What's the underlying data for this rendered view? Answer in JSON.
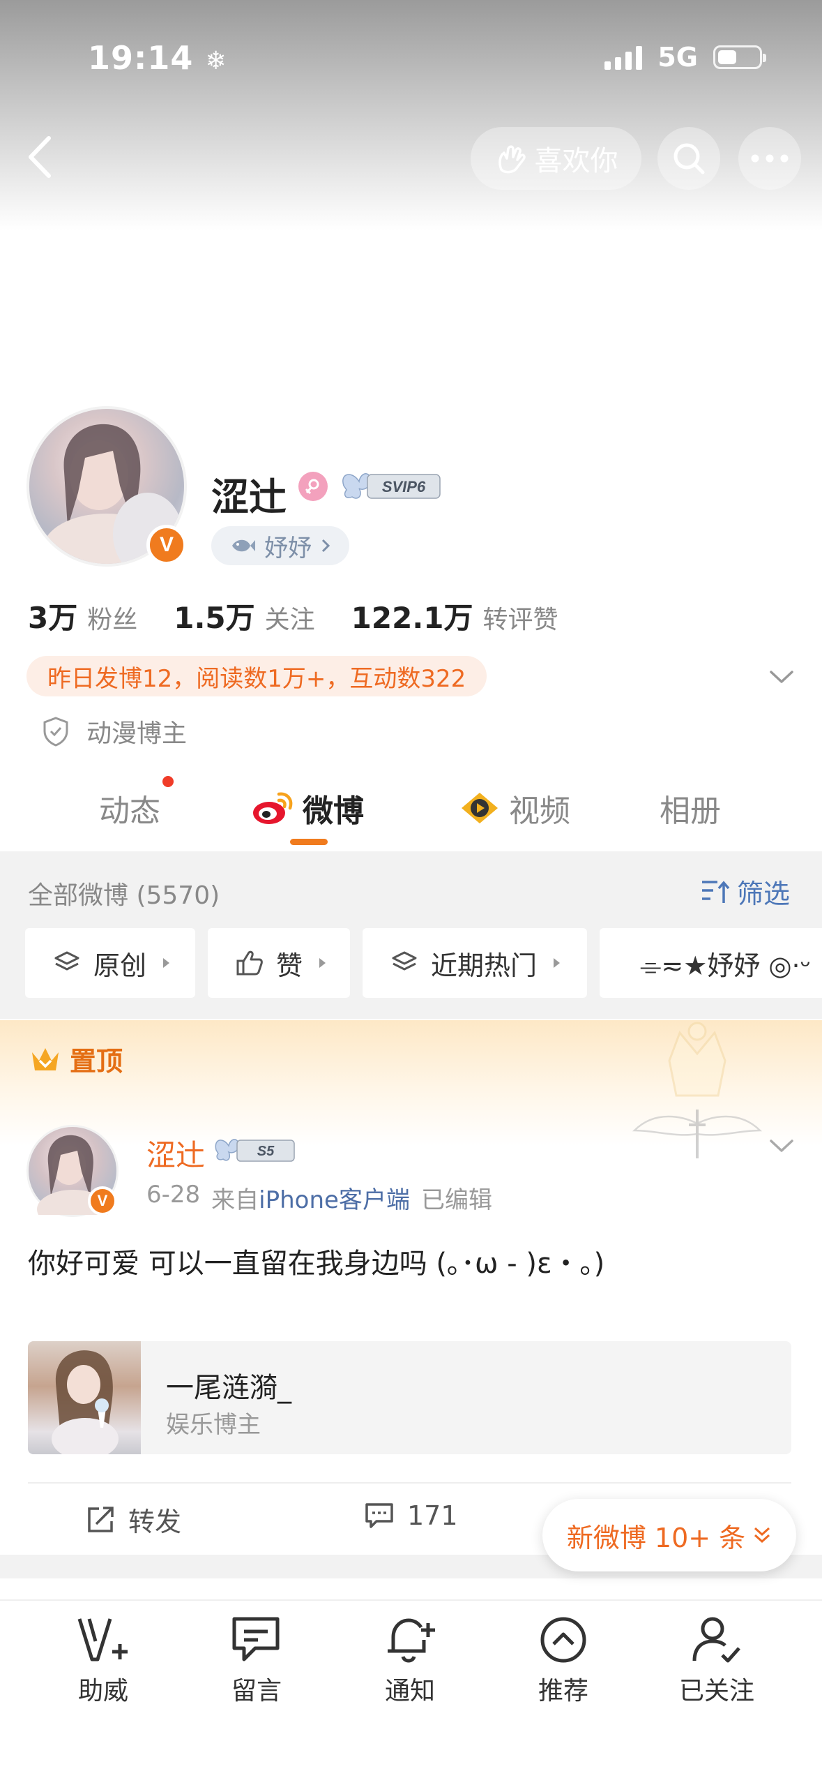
{
  "status_bar": {
    "time": "19:14",
    "network": "5G"
  },
  "header": {
    "like_you_label": "喜欢你"
  },
  "profile": {
    "name": "涩辻",
    "tag_name": "妤妤",
    "stats": [
      {
        "num": "3万",
        "label": "粉丝"
      },
      {
        "num": "1.5万",
        "label": "关注"
      },
      {
        "num": "122.1万",
        "label": "转评赞"
      }
    ],
    "summary": "昨日发博12，阅读数1万+，互动数322",
    "category": "动漫博主",
    "svip_text": "SVIP6"
  },
  "tabs": [
    {
      "label": "动态"
    },
    {
      "label": "微博"
    },
    {
      "label": "视频"
    },
    {
      "label": "相册"
    }
  ],
  "feed": {
    "all_count": "全部微博 (5570)",
    "filter_label": "筛选",
    "chips": [
      {
        "label": "原创"
      },
      {
        "label": "赞"
      },
      {
        "label": "近期热门"
      },
      {
        "label": "⌯≂★妤妤 ◎·ᵕ"
      }
    ]
  },
  "pinned": {
    "label": "置顶",
    "author": "涩辻",
    "badge_text": "S5",
    "date": "6-28",
    "source_prefix": "来自",
    "source": "iPhone客户端",
    "edited": "已编辑",
    "text": "你好可爱 可以一直留在我身边吗 (｡･ω - )ε・｡)",
    "shared_card": {
      "name": "一尾涟漪_",
      "subtitle": "娱乐博主"
    },
    "actions": {
      "repost": "转发",
      "comments": "171"
    }
  },
  "new_posts_label": "新微博 10+ 条",
  "bottom_nav": [
    {
      "label": "助威"
    },
    {
      "label": "留言"
    },
    {
      "label": "通知"
    },
    {
      "label": "推荐"
    },
    {
      "label": "已关注"
    }
  ],
  "colors": {
    "accent": "#ee6a22",
    "link": "#4d6ea6",
    "vip_badge": "#f07b1e"
  }
}
